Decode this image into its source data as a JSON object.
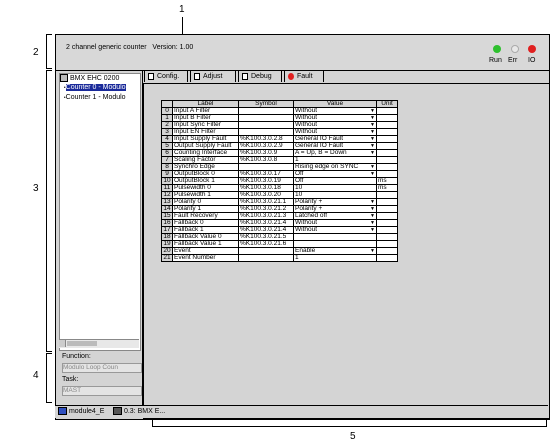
{
  "callouts": {
    "c1": "1",
    "c2": "2",
    "c3": "3",
    "c4": "4",
    "c5": "5"
  },
  "header": {
    "title": "2 channel generic counter",
    "version": "Version: 1.00",
    "leds": [
      {
        "label": "Run",
        "color": "#2ec02e"
      },
      {
        "label": "Err",
        "color": "#dddddd"
      },
      {
        "label": "IO",
        "color": "#e02020"
      }
    ]
  },
  "tree": {
    "root": "BMX EHC 0200",
    "items": [
      "Counter 0 - Modulo",
      "Counter 1 - Modulo"
    ]
  },
  "function": {
    "label": "Function:",
    "value": "Modulo Loop Coun"
  },
  "task": {
    "label": "Task:",
    "value": "MAST"
  },
  "tabs": [
    {
      "label": "Config."
    },
    {
      "label": "Adjust"
    },
    {
      "label": "Debug"
    },
    {
      "label": "Fault"
    }
  ],
  "table": {
    "headers": [
      "",
      "Label",
      "Symbol",
      "Value",
      "Unit"
    ],
    "rows": [
      [
        "0",
        "Input A Filter",
        "",
        "Without",
        ""
      ],
      [
        "1",
        "Input B Filter",
        "",
        "Without",
        ""
      ],
      [
        "2",
        "Input Sync Filter",
        "",
        "Without",
        ""
      ],
      [
        "3",
        "Input EN Filter",
        "",
        "Without",
        ""
      ],
      [
        "4",
        "Input Supply Fault",
        "%K100.3.0.2.8",
        "General IO Fault",
        ""
      ],
      [
        "5",
        "Output Supply Fault",
        "%K100.3.0.2.9",
        "General IO Fault",
        ""
      ],
      [
        "6",
        "Counting Interface",
        "%K100.3.0.9",
        "A = Up, B = Down",
        ""
      ],
      [
        "7",
        "Scaling Factor",
        "%K100.3.0.8",
        "1",
        ""
      ],
      [
        "8",
        "Synchro Edge",
        "",
        "Rising edge on SYNC",
        ""
      ],
      [
        "9",
        "OutputBlock 0",
        "%K100.3.0.17",
        "Off",
        ""
      ],
      [
        "10",
        "OutputBlock 1",
        "%K100.3.0.19",
        "Off",
        "ms"
      ],
      [
        "11",
        "Pulsewidth 0",
        "%K100.3.0.18",
        "10",
        "ms"
      ],
      [
        "12",
        "Pulsewidth 1",
        "%K100.3.0.20",
        "10",
        ""
      ],
      [
        "13",
        "Polarity 0",
        "%K100.3.0.21.1",
        "Polarity +",
        ""
      ],
      [
        "14",
        "Polarity 1",
        "%K100.3.0.21.2",
        "Polarity +",
        ""
      ],
      [
        "15",
        "Fault Recovery",
        "%K100.3.0.21.3",
        "Latched off",
        ""
      ],
      [
        "16",
        "Fallback 0",
        "%K100.3.0.21.4",
        "Without",
        ""
      ],
      [
        "17",
        "Fallback 1",
        "%K100.3.0.21.4",
        "Without",
        ""
      ],
      [
        "18",
        "Fallback Value 0",
        "%K100.3.0.21.5",
        "",
        ""
      ],
      [
        "19",
        "Fallback Value 1",
        "%K100.3.0.21.6",
        "",
        ""
      ],
      [
        "20",
        "Event",
        "",
        "Enable",
        ""
      ],
      [
        "21",
        "Event Number",
        "",
        "1",
        ""
      ]
    ],
    "dropdown_rows": [
      0,
      1,
      2,
      3,
      4,
      5,
      6,
      8,
      9,
      13,
      14,
      15,
      16,
      17,
      20
    ]
  },
  "taskbar": {
    "items": [
      "module4_E",
      "0.3: BMX E..."
    ]
  }
}
